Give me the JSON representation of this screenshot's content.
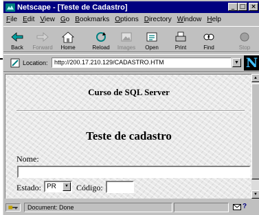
{
  "window": {
    "title": "Netscape - [Teste de Cadastro]",
    "controls": [
      "minimize",
      "maximize",
      "close"
    ]
  },
  "menu": [
    {
      "label": "File",
      "mnemonic": "F"
    },
    {
      "label": "Edit",
      "mnemonic": "E"
    },
    {
      "label": "View",
      "mnemonic": "V"
    },
    {
      "label": "Go",
      "mnemonic": "G"
    },
    {
      "label": "Bookmarks",
      "mnemonic": "B"
    },
    {
      "label": "Options",
      "mnemonic": "O"
    },
    {
      "label": "Directory",
      "mnemonic": "D"
    },
    {
      "label": "Window",
      "mnemonic": "W"
    },
    {
      "label": "Help",
      "mnemonic": "H"
    }
  ],
  "toolbar": {
    "back": "Back",
    "forward": "Forward",
    "home": "Home",
    "reload": "Reload",
    "images": "Images",
    "open": "Open",
    "print": "Print",
    "find": "Find",
    "stop": "Stop"
  },
  "location": {
    "label": "Location:",
    "url": "http://200.17.210.129/CADASTRO.HTM",
    "logo_letter": "N"
  },
  "page": {
    "subtitle": "Curso de SQL Server",
    "title": "Teste de cadastro",
    "nome_label": "Nome:",
    "nome_value": "",
    "estado_label": "Estado:",
    "estado_selected": "PR",
    "codigo_label": "Código:",
    "codigo_value": ""
  },
  "status": {
    "text": "Document: Done"
  },
  "colors": {
    "titlebar": "#000080",
    "chrome": "#c0c0c0",
    "logo_bg": "#000000",
    "logo_fg": "#40c0ff"
  },
  "icons": [
    "back-arrow-icon",
    "forward-arrow-icon",
    "home-icon",
    "reload-icon",
    "images-icon",
    "open-icon",
    "print-icon",
    "find-icon",
    "stop-icon",
    "bookmark-icon",
    "mail-icon",
    "help-icon"
  ]
}
